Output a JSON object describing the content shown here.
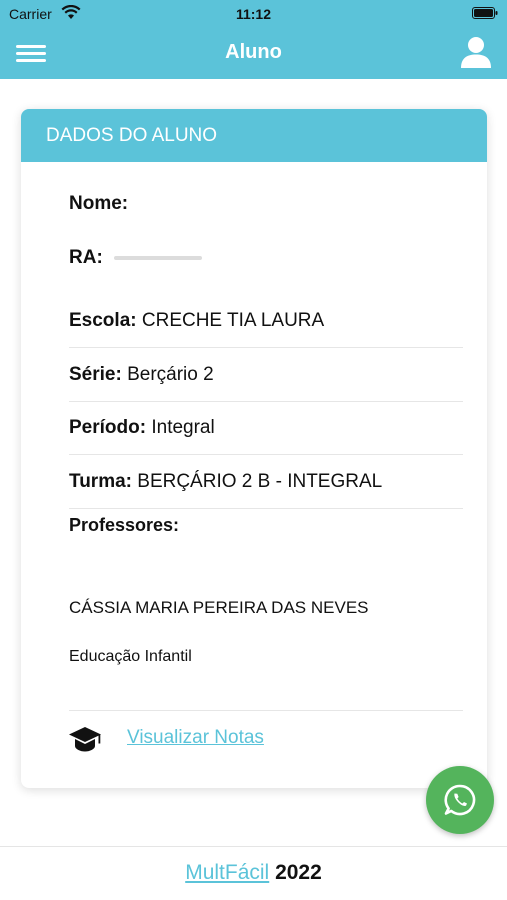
{
  "status_bar": {
    "carrier": "Carrier",
    "time": "11:12",
    "wifi_icon": "wifi-icon",
    "battery_icon": "battery-icon"
  },
  "nav": {
    "title": "Aluno",
    "menu_icon": "hamburger-icon",
    "user_icon": "user-icon"
  },
  "card": {
    "header": "DADOS DO ALUNO",
    "fields": {
      "nome": {
        "label": "Nome:",
        "value": ""
      },
      "ra": {
        "label": "RA:",
        "value": ""
      },
      "escola": {
        "label": "Escola:",
        "value": "CRECHE TIA LAURA"
      },
      "serie": {
        "label": "Série:",
        "value": "Berçário 2"
      },
      "periodo": {
        "label": "Período:",
        "value": "Integral"
      },
      "turma": {
        "label": "Turma:",
        "value": "BERÇÁRIO 2 B - INTEGRAL"
      }
    },
    "professores_label": "Professores:",
    "professores": [
      {
        "name": "CÁSSIA MARIA PEREIRA DAS NEVES",
        "area": "Educação Infantil"
      }
    ],
    "notas_link": "Visualizar Notas",
    "notas_icon": "graduation-cap-icon"
  },
  "whatsapp": {
    "icon": "whatsapp-icon"
  },
  "footer": {
    "brand": "MultFácil",
    "year": "2022"
  },
  "colors": {
    "accent": "#5bc3d9",
    "whatsapp": "#54b45c"
  }
}
